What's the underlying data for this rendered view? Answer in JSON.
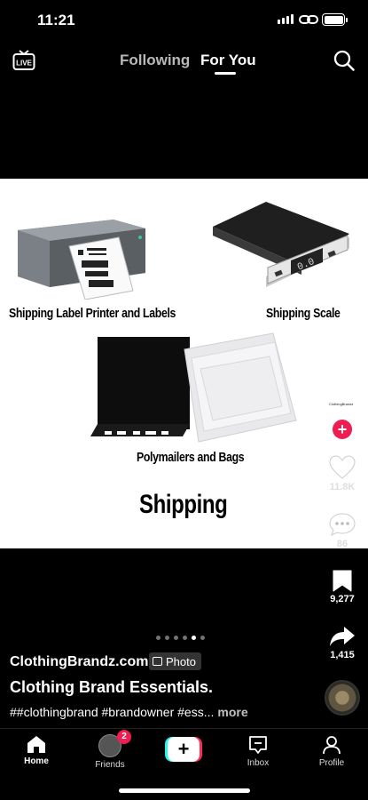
{
  "status_bar": {
    "time": "11:21"
  },
  "top_nav": {
    "tabs": [
      {
        "label": "Following"
      },
      {
        "label": "For You"
      }
    ],
    "live_icon_label": "LIVE"
  },
  "photo": {
    "captions": {
      "printer": "Shipping Label Printer and Labels",
      "scale": "Shipping Scale",
      "polymailers": "Polymailers and Bags",
      "heading": "Shipping"
    },
    "scale_display": "0.0"
  },
  "rail": {
    "likes": "11.8K",
    "comments": "86",
    "bookmarks": "9,277",
    "shares": "1,415"
  },
  "carousel": {
    "count": 6,
    "active_index": 4
  },
  "post": {
    "author": "ClothingBrandz.com",
    "tag": "Photo",
    "title": "Clothing Brand Essentials.",
    "hashtags": "##clothingbrand #brandowner #ess...",
    "more": "more"
  },
  "bottom_nav": {
    "home": "Home",
    "friends": "Friends",
    "friends_badge": "2",
    "inbox": "Inbox",
    "profile": "Profile"
  },
  "colors": {
    "accent_red": "#ee1d52",
    "create_cyan": "#25f4ee",
    "create_red": "#fe2c55"
  },
  "icons": [
    "live-icon",
    "search-icon",
    "heart-icon",
    "comment-icon",
    "bookmark-icon",
    "share-icon",
    "home-icon",
    "inbox-icon",
    "profile-icon",
    "plus-icon"
  ]
}
